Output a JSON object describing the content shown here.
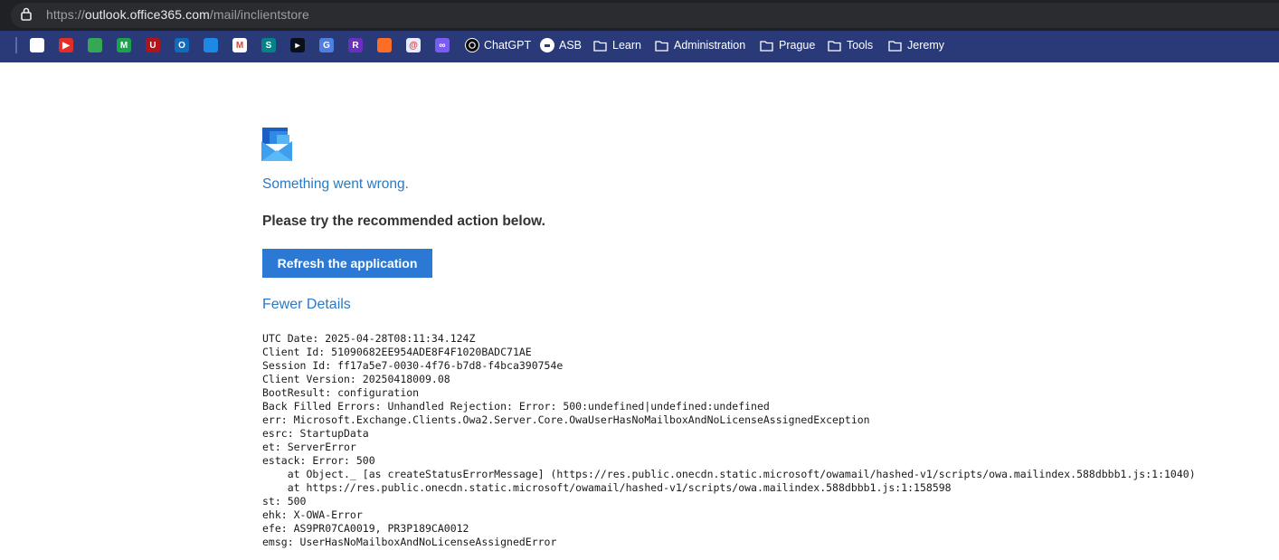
{
  "browser": {
    "url_scheme": "https://",
    "url_host": "outlook.office365.com",
    "url_path": "/mail/inclientstore",
    "lock_icon": "lock-icon"
  },
  "bookmarks": {
    "icons": [
      {
        "name": "calendar-icon",
        "color": "#ffffff",
        "glyph": ""
      },
      {
        "name": "youtube-icon",
        "color": "#e52d27",
        "glyph": "▶"
      },
      {
        "name": "maps-pin-icon",
        "color": "#34a853",
        "glyph": ""
      },
      {
        "name": "m-app-icon",
        "color": "#1aa34a",
        "glyph": "M"
      },
      {
        "name": "u-app-icon",
        "color": "#b0141a",
        "glyph": "U"
      },
      {
        "name": "outlook-icon",
        "color": "#0f6cbd",
        "glyph": "O"
      },
      {
        "name": "onedrive-icon",
        "color": "#1e88e5",
        "glyph": ""
      },
      {
        "name": "gmail-icon",
        "color": "#ffffff",
        "glyph": "M"
      },
      {
        "name": "sharepoint-icon",
        "color": "#038387",
        "glyph": "S"
      },
      {
        "name": "media-player-icon",
        "color": "#0b0f19",
        "glyph": "▸"
      },
      {
        "name": "translate-icon",
        "color": "#4f7fe0",
        "glyph": "G"
      },
      {
        "name": "r-app-icon",
        "color": "#6b2fbf",
        "glyph": "R"
      },
      {
        "name": "gitlab-icon",
        "color": "#fc6d26",
        "glyph": ""
      },
      {
        "name": "spiral-app-icon",
        "color": "#e8ecff",
        "glyph": "@"
      },
      {
        "name": "loop-app-icon",
        "color": "#7b5cf0",
        "glyph": "∞"
      }
    ],
    "items": [
      {
        "label": "ChatGPT",
        "icon": "chatgpt-icon"
      },
      {
        "label": "ASB",
        "icon": "asb-icon"
      },
      {
        "label": "Learn",
        "icon": "folder-icon"
      },
      {
        "label": "Administration",
        "icon": "folder-icon"
      },
      {
        "label": "Prague",
        "icon": "folder-icon"
      },
      {
        "label": "Tools",
        "icon": "folder-icon"
      },
      {
        "label": "Jeremy",
        "icon": "folder-icon"
      }
    ]
  },
  "main": {
    "logo_icon": "outlook-logo-icon",
    "title": "Something went wrong.",
    "subtitle": "Please try the recommended action below.",
    "refresh_button": "Refresh the application",
    "fewer_details": "Fewer Details",
    "details_lines": [
      "UTC Date: 2025-04-28T08:11:34.124Z",
      "Client Id: 51090682EE954ADE8F4F1020BADC71AE",
      "Session Id: ff17a5e7-0030-4f76-b7d8-f4bca390754e",
      "Client Version: 20250418009.08",
      "BootResult: configuration",
      "Back Filled Errors: Unhandled Rejection: Error: 500:undefined|undefined:undefined",
      "err: Microsoft.Exchange.Clients.Owa2.Server.Core.OwaUserHasNoMailboxAndNoLicenseAssignedException",
      "esrc: StartupData",
      "et: ServerError",
      "estack: Error: 500",
      "    at Object._ [as createStatusErrorMessage] (https://res.public.onecdn.static.microsoft/owamail/hashed-v1/scripts/owa.mailindex.588dbbb1.js:1:1040)",
      "    at https://res.public.onecdn.static.microsoft/owamail/hashed-v1/scripts/owa.mailindex.588dbbb1.js:1:158598",
      "st: 500",
      "ehk: X-OWA-Error",
      "efe: AS9PR07CA0019, PR3P189CA0012",
      "emsg: UserHasNoMailboxAndNoLicenseAssignedError"
    ]
  },
  "colors": {
    "accent": "#2b79c2",
    "button": "#2b79d4",
    "bookmark_bar": "#2a3a78"
  }
}
